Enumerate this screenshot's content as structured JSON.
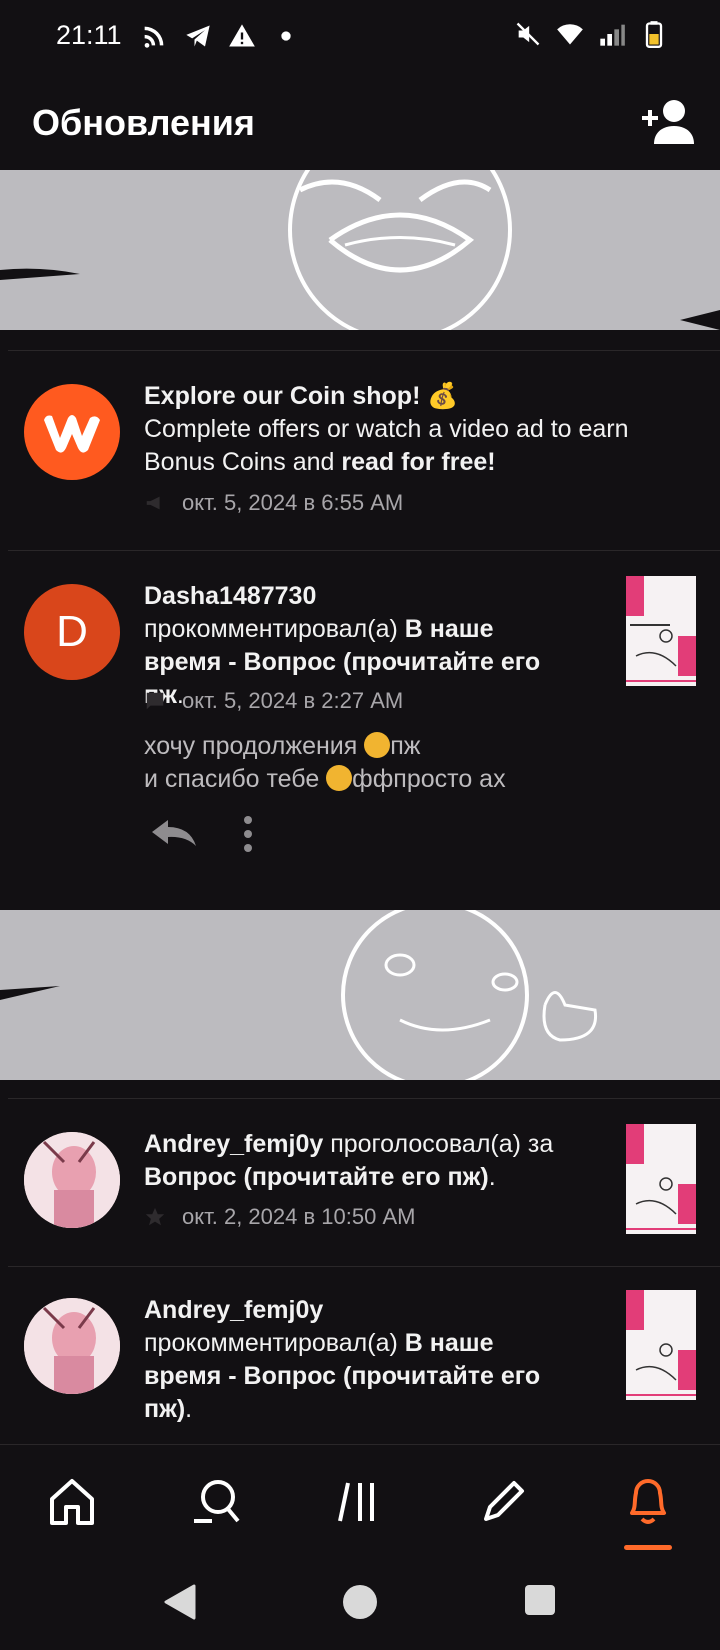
{
  "status_bar": {
    "time": "21:11",
    "left_icons": [
      "rss-icon",
      "telegram-icon",
      "warning-icon",
      "dot-icon"
    ],
    "right_icons": [
      "mute-icon",
      "wifi-icon",
      "signal-icon",
      "battery-icon"
    ]
  },
  "header": {
    "title": "Обновления",
    "add_user_icon": "add-user-icon"
  },
  "notifications": [
    {
      "avatar": "wattpad-logo",
      "title": "Explore our Coin shop! 💰",
      "line2": "Complete offers or watch a video ad to earn",
      "line3_plain": "Bonus Coins and ",
      "line3_bold": "read for free!",
      "timestamp": "окт. 5, 2024 в 6:55 AM",
      "meta_icon": "megaphone-icon"
    },
    {
      "avatar_letter": "D",
      "user": "Dasha1487730",
      "action": "прокомментировал(а) ",
      "story_a": "В наше",
      "story_b": "время - Вопрос (прочитайте его",
      "story_c": "пж",
      "story_end": ".",
      "timestamp": "окт. 5, 2024 в 2:27 AM",
      "meta_icon": "comment-icon",
      "comment_line1_a": "хочу продолжения ",
      "comment_line1_b": "пж",
      "comment_line2_a": "и спасибо тебе ",
      "comment_line2_b": "ффпросто ах",
      "actions": [
        "reply-icon",
        "more-icon"
      ]
    },
    {
      "user": "Andrey_femj0y",
      "action": " проголосовал(а) за",
      "story": "Вопрос (прочитайте его пж)",
      "story_end": ".",
      "timestamp": "окт. 2, 2024 в 10:50 AM",
      "meta_icon": "star-icon"
    },
    {
      "user": "Andrey_femj0y",
      "action": "прокомментировал(а) ",
      "story_a": "В наше",
      "story_b": "время - Вопрос (прочитайте его",
      "story_c": "пж)",
      "story_end": "."
    }
  ],
  "bottom_nav": [
    "home-icon",
    "search-icon",
    "library-icon",
    "write-icon",
    "bell-icon"
  ],
  "bottom_nav_active": "bell-icon",
  "system_nav": [
    "back-icon",
    "home-circle-icon",
    "recents-icon"
  ],
  "colors": {
    "accent": "#ff6a2a",
    "background": "#121013",
    "wattpad": "#ff5a1f",
    "avatar_d": "#d9461b"
  }
}
